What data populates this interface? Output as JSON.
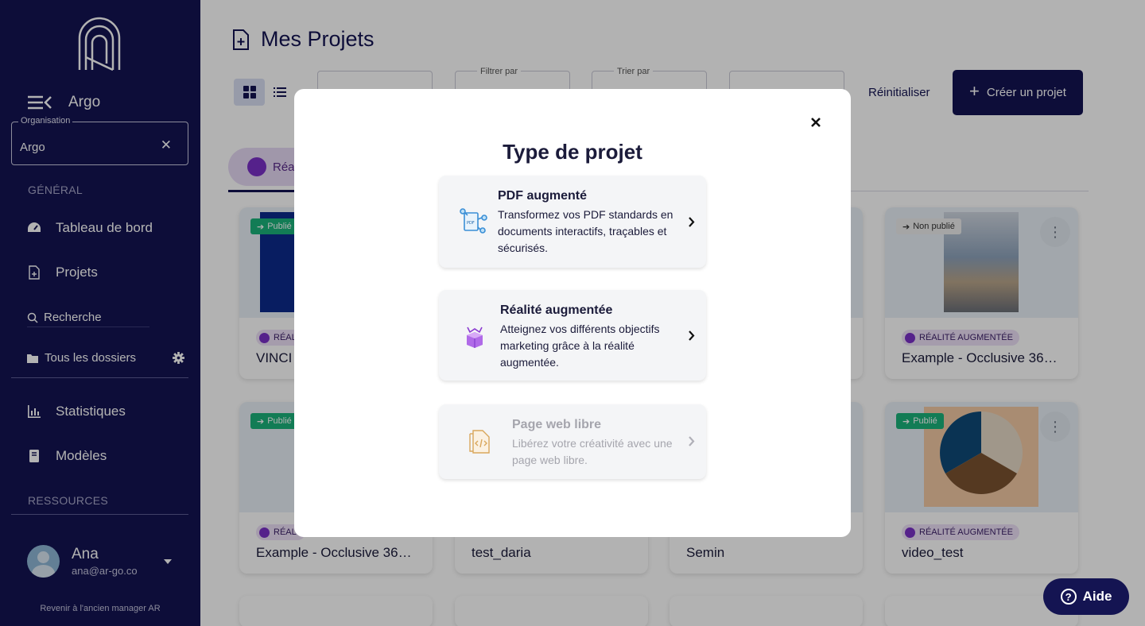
{
  "sidebar": {
    "brand": "Argo",
    "organization": {
      "label": "Organisation",
      "value": "Argo"
    },
    "sections": {
      "general": "GÉNÉRAL",
      "resources": "RESSOURCES"
    },
    "nav": {
      "dashboard": "Tableau de bord",
      "projects": "Projets",
      "search": "Recherche",
      "folders": "Tous les dossiers",
      "statistics": "Statistiques",
      "templates": "Modèles"
    },
    "user": {
      "name": "Ana",
      "email": "ana@ar-go.co"
    },
    "old_manager": "Revenir à l'ancien manager AR"
  },
  "main": {
    "title": "Mes Projets",
    "filters": {
      "filter_label": "Filtrer par",
      "sort_label": "Trier par"
    },
    "reset": "Réinitialiser",
    "create": "Créer un projet",
    "tab": "Réal",
    "cards": [
      {
        "status": "Publié",
        "tag": "RÉALI",
        "title": "VINCI ("
      },
      {
        "status": "Non publié",
        "tag": "RÉALITÉ AUGMENTÉE",
        "title": "Example - Occlusive 360 ..."
      },
      {
        "status": "Publié",
        "tag": "RÉALI",
        "title": "Example - Occlusive 360 ..."
      },
      {
        "title": "test_daria"
      },
      {
        "title": "Semin"
      },
      {
        "status": "Publié",
        "tag": "RÉALITÉ AUGMENTÉE",
        "title": "video_test"
      }
    ]
  },
  "modal": {
    "title": "Type de projet",
    "options": [
      {
        "title": "PDF augmenté",
        "description": "Transformez vos PDF standards en documents interactifs, traçables et sécurisés.",
        "icon": "pdf-nodes-icon"
      },
      {
        "title": "Réalité augmentée",
        "description": "Atteignez vos différents objectifs marketing grâce à la réalité augmentée.",
        "icon": "ar-cube-icon"
      },
      {
        "title": "Page web libre",
        "description": "Libérez votre créativité avec une page web libre.",
        "icon": "code-file-icon"
      }
    ]
  },
  "help": {
    "label": "Aide"
  },
  "colors": {
    "navy": "#141452",
    "published": "#1bb27a",
    "ar_purple": "#7a30c8"
  }
}
